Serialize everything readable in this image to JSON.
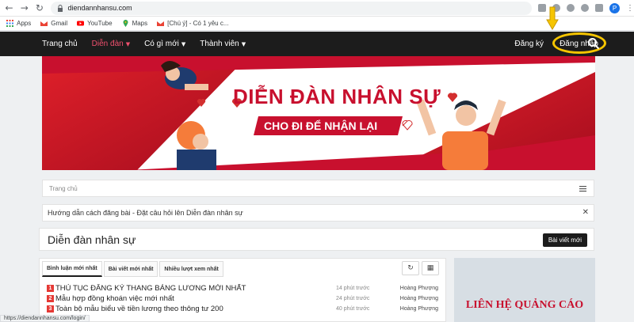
{
  "browser": {
    "url": "diendannhansu.com",
    "profile_initial": "P",
    "bookmarks": [
      {
        "label": "Apps",
        "icon": "apps-grid-icon"
      },
      {
        "label": "Gmail",
        "icon": "gmail-icon"
      },
      {
        "label": "YouTube",
        "icon": "youtube-icon"
      },
      {
        "label": "Maps",
        "icon": "maps-icon"
      },
      {
        "label": "[Chú ý] - Có 1 yêu c...",
        "icon": "gmail-icon"
      }
    ],
    "status_url": "https://diendannhansu.com/login/"
  },
  "nav": {
    "items": [
      {
        "label": "Trang chủ",
        "active": false,
        "caret": false
      },
      {
        "label": "Diễn đàn",
        "active": true,
        "caret": true
      },
      {
        "label": "Có gì mới",
        "active": false,
        "caret": true
      },
      {
        "label": "Thành viên",
        "active": false,
        "caret": true
      }
    ],
    "register": "Đăng ký",
    "login": "Đăng nhập"
  },
  "banner": {
    "title": "DIỄN ĐÀN NHÂN SỰ",
    "subtitle": "CHO ĐI ĐỂ NHẬN LẠI"
  },
  "breadcrumb": {
    "home": "Trang chủ"
  },
  "notice": {
    "text": "Hướng dẫn cách đăng bài - Đặt câu hỏi lên Diễn đàn nhân sự"
  },
  "forum": {
    "title": "Diễn đàn nhân sự",
    "new_post": "Bài viết mới"
  },
  "tabs": [
    {
      "label": "Bình luận mới nhất",
      "active": true
    },
    {
      "label": "Bài viết mới nhất",
      "active": false
    },
    {
      "label": "Nhiều lượt xem nhất",
      "active": false
    }
  ],
  "threads": [
    {
      "num": "1",
      "title": "THỦ TỤC ĐĂNG KÝ THANG BẢNG LƯƠNG MỚI NHẤT",
      "time": "14 phút trước",
      "author": "Hoàng Phượng"
    },
    {
      "num": "2",
      "title": "Mẫu hợp đồng khoán việc mới nhất",
      "time": "24 phút trước",
      "author": "Hoàng Phượng"
    },
    {
      "num": "3",
      "title": "Toàn bộ mẫu biểu về tiền lương theo thông tư 200",
      "time": "40 phút trước",
      "author": "Hoàng Phượng"
    }
  ],
  "ad": {
    "text": "LIÊN HỆ QUẢNG CÁO"
  },
  "colors": {
    "nav_bg": "#1c1c1c",
    "accent_red": "#c8102e",
    "active_nav": "#f0506e",
    "highlight_yellow": "#f6c500"
  }
}
